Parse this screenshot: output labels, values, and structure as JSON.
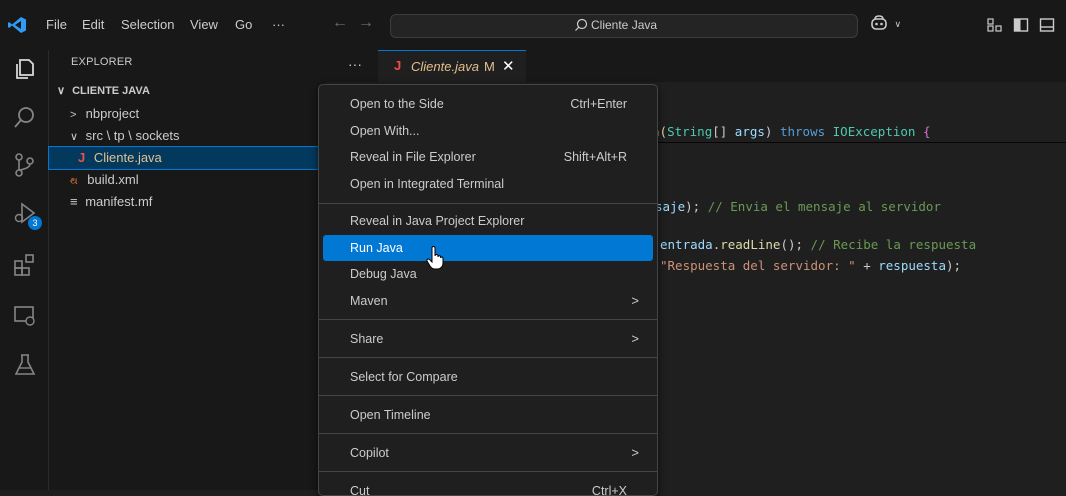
{
  "titlebar": {
    "menus": [
      "File",
      "Edit",
      "Selection",
      "View",
      "Go",
      "···"
    ],
    "search_text": "Cliente Java",
    "copilot_chevron": "∨"
  },
  "activity": {
    "scm_badge": "3"
  },
  "sidebar": {
    "title": "EXPLORER",
    "items": [
      {
        "label": "CLIENTE JAVA",
        "chevron": "∨"
      },
      {
        "label": "nbproject",
        "chevron": ">"
      },
      {
        "label": "src \\ tp \\ sockets",
        "chevron": "∨"
      },
      {
        "label": "Cliente.java",
        "icon": "J"
      },
      {
        "label": "build.xml",
        "icon": "થ"
      },
      {
        "label": "manifest.mf",
        "icon": "≡"
      }
    ]
  },
  "editor": {
    "tab_more": "···",
    "tab": {
      "icon": "J",
      "name": "Cliente.java",
      "modified": "M",
      "close": "✕"
    },
    "lines": [
      {
        "a": "n(",
        "b": "String",
        "c": "[] ",
        "d": "args",
        "e": ") ",
        "f": "throws",
        "g": " ",
        "h": "IOException",
        "i": " {"
      },
      {
        "a": "saje",
        "b": "); ",
        "c": "// Envia el mensaje al servidor"
      },
      {
        "a": "entrada",
        "b": ".",
        "c": "readLine",
        "d": "(); ",
        "e": "// Recibe la respuesta"
      },
      {
        "a": "\"Respuesta del servidor: \"",
        "b": " + ",
        "c": "respuesta",
        "d": ");"
      }
    ]
  },
  "context_menu": {
    "items": [
      {
        "label": "Open to the Side",
        "shortcut": "Ctrl+Enter"
      },
      {
        "label": "Open With..."
      },
      {
        "label": "Reveal in File Explorer",
        "shortcut": "Shift+Alt+R"
      },
      {
        "label": "Open in Integrated Terminal"
      },
      {
        "label": "Reveal in Java Project Explorer"
      },
      {
        "label": "Run Java"
      },
      {
        "label": "Debug Java"
      },
      {
        "label": "Maven",
        "submenu": ">"
      },
      {
        "label": "Share",
        "submenu": ">"
      },
      {
        "label": "Select for Compare"
      },
      {
        "label": "Open Timeline"
      },
      {
        "label": "Copilot",
        "submenu": ">"
      },
      {
        "label": "Cut",
        "shortcut": "Ctrl+X"
      }
    ]
  },
  "colors": {
    "accent": "#0078d4",
    "selection": "#04395e",
    "modified": "#e2c08d",
    "java": "#f14c4c"
  }
}
